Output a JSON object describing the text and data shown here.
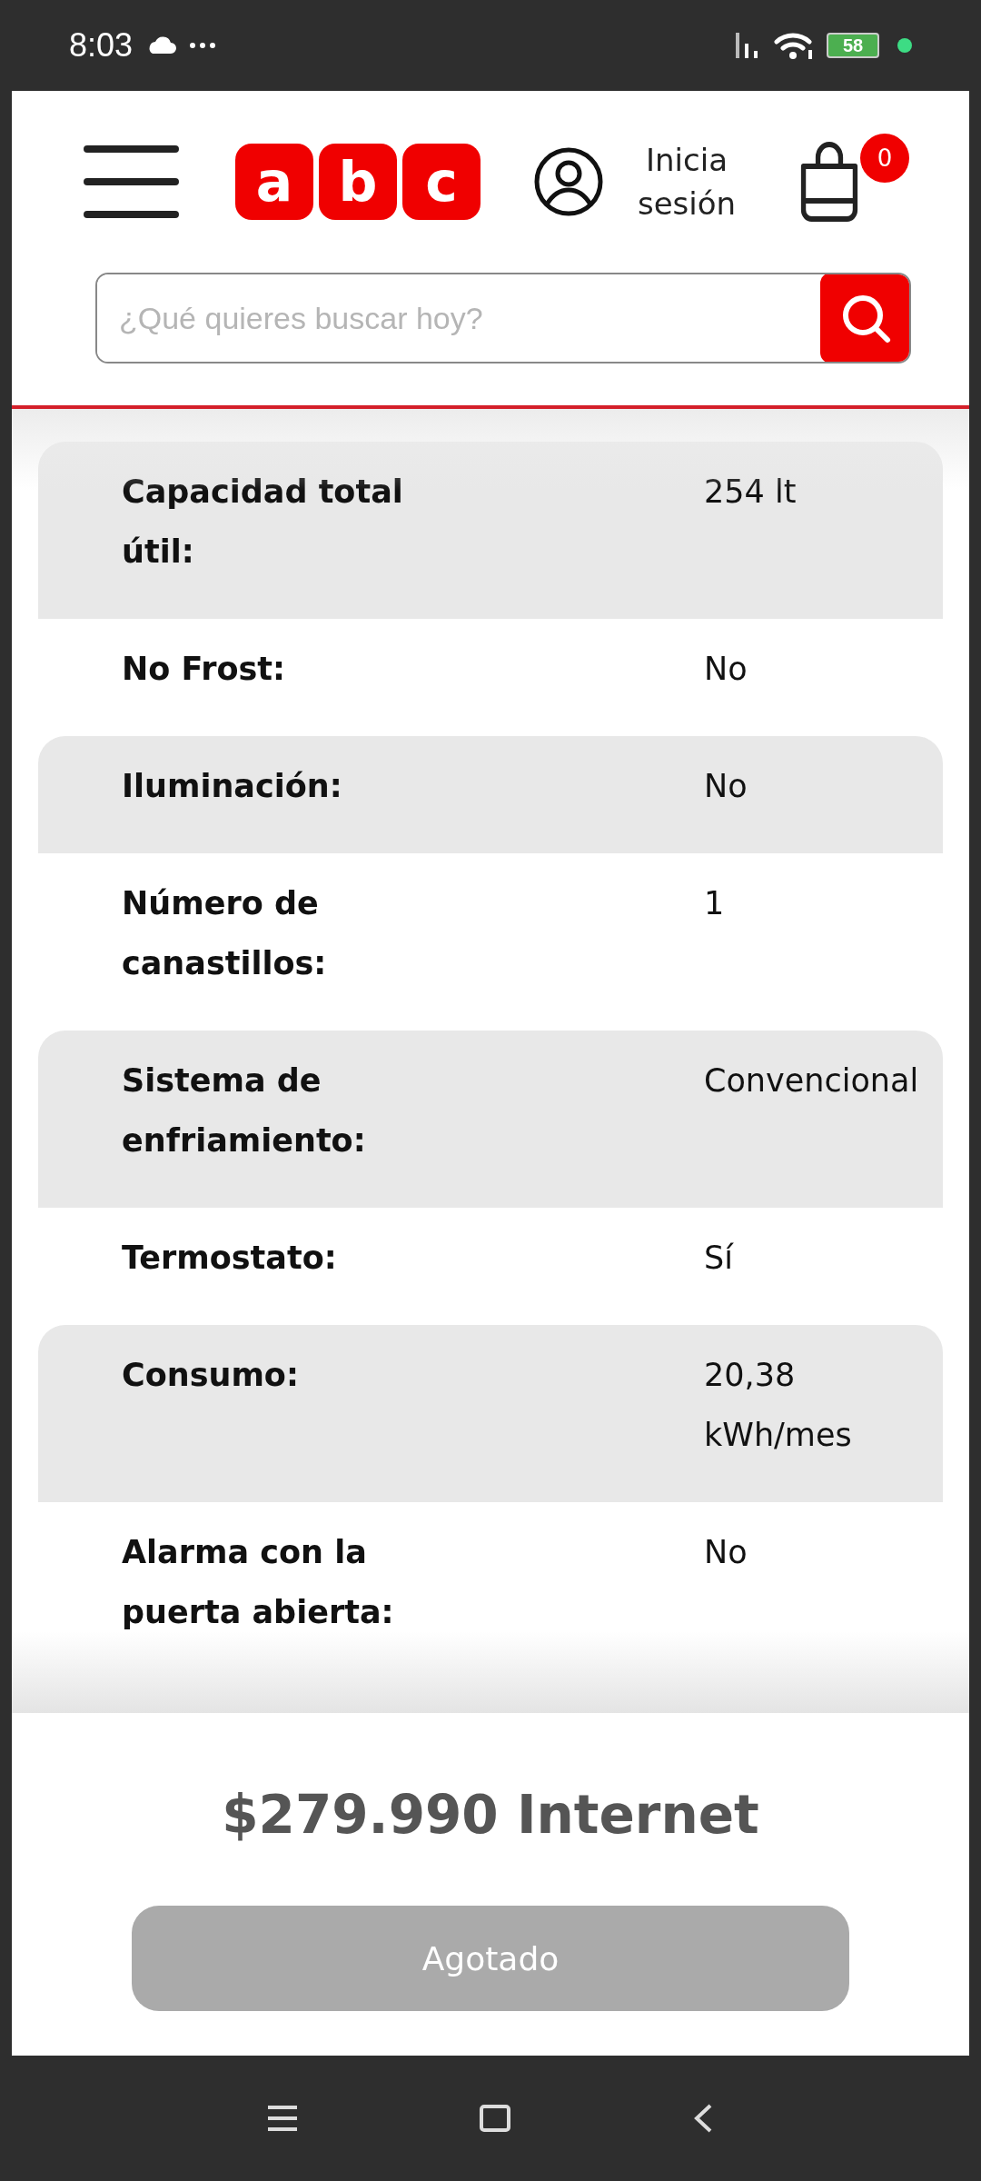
{
  "status_bar": {
    "time": "8:03",
    "battery": "58"
  },
  "header": {
    "logo_letters": [
      "a",
      "b",
      "c"
    ],
    "login": "Inicia sesión",
    "cart_count": "0"
  },
  "search": {
    "placeholder": "¿Qué quieres buscar hoy?"
  },
  "specs": [
    {
      "label": "Capacidad total útil:",
      "value": "254 lt"
    },
    {
      "label": "No Frost:",
      "value": "No"
    },
    {
      "label": "Iluminación:",
      "value": "No"
    },
    {
      "label": "Número de canastillos:",
      "value": "1"
    },
    {
      "label": "Sistema de enfriamiento:",
      "value": "Convencional"
    },
    {
      "label": "Termostato:",
      "value": "Sí"
    },
    {
      "label": "Consumo:",
      "value": "20,38 kWh/mes"
    },
    {
      "label": "Alarma con la puerta abierta:",
      "value": "No"
    }
  ],
  "price": "$279.990 Internet",
  "buy_button": {
    "label": "Agotado",
    "disabled": true
  }
}
